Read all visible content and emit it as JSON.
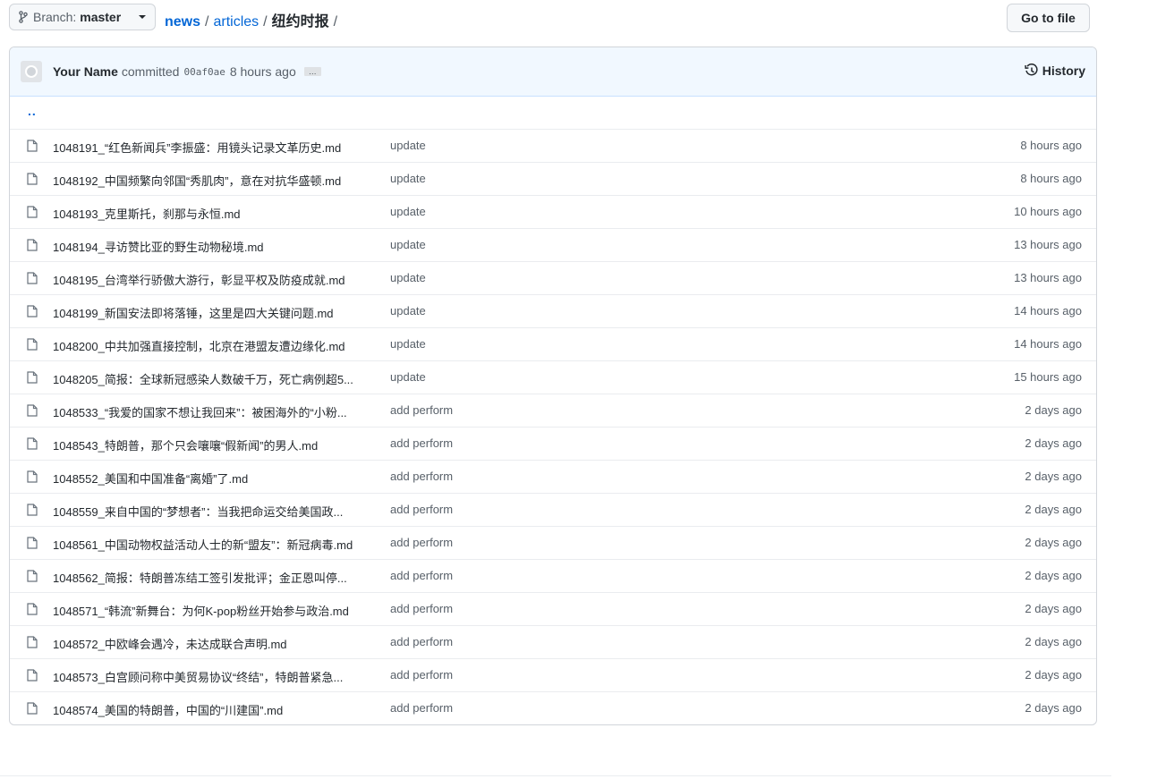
{
  "branch": {
    "label": "Branch:",
    "name": "master"
  },
  "breadcrumb": {
    "root": "news",
    "sep1": "/",
    "segment": "articles",
    "sep2": "/",
    "final": "纽约时报",
    "sep3": "/"
  },
  "goto_file": "Go to file",
  "commit": {
    "author": "Your Name",
    "verb": "committed",
    "sha": "00af0ae",
    "time": "8 hours ago",
    "ellipsis": "…",
    "history": "History"
  },
  "updir": "..",
  "files": [
    {
      "name": "1048191_“红色新闻兵”李振盛：用镜头记录文革历史.md",
      "message": "update",
      "age": "8 hours ago"
    },
    {
      "name": "1048192_中国频繁向邻国“秀肌肉”，意在对抗华盛顿.md",
      "message": "update",
      "age": "8 hours ago"
    },
    {
      "name": "1048193_克里斯托，刹那与永恒.md",
      "message": "update",
      "age": "10 hours ago"
    },
    {
      "name": "1048194_寻访赞比亚的野生动物秘境.md",
      "message": "update",
      "age": "13 hours ago"
    },
    {
      "name": "1048195_台湾举行骄傲大游行，彰显平权及防疫成就.md",
      "message": "update",
      "age": "13 hours ago"
    },
    {
      "name": "1048199_新国安法即将落锤，这里是四大关键问题.md",
      "message": "update",
      "age": "14 hours ago"
    },
    {
      "name": "1048200_中共加强直接控制，北京在港盟友遭边缘化.md",
      "message": "update",
      "age": "14 hours ago"
    },
    {
      "name": "1048205_简报：全球新冠感染人数破千万，死亡病例超5...",
      "message": "update",
      "age": "15 hours ago"
    },
    {
      "name": "1048533_“我爱的国家不想让我回来”：被困海外的“小粉...",
      "message": "add perform",
      "age": "2 days ago"
    },
    {
      "name": "1048543_特朗普，那个只会嚷嚷“假新闻”的男人.md",
      "message": "add perform",
      "age": "2 days ago"
    },
    {
      "name": "1048552_美国和中国准备“离婚”了.md",
      "message": "add perform",
      "age": "2 days ago"
    },
    {
      "name": "1048559_来自中国的“梦想者”：当我把命运交给美国政...",
      "message": "add perform",
      "age": "2 days ago"
    },
    {
      "name": "1048561_中国动物权益活动人士的新“盟友”：新冠病毒.md",
      "message": "add perform",
      "age": "2 days ago"
    },
    {
      "name": "1048562_简报：特朗普冻结工签引发批评；金正恩叫停...",
      "message": "add perform",
      "age": "2 days ago"
    },
    {
      "name": "1048571_“韩流”新舞台：为何K-pop粉丝开始参与政治.md",
      "message": "add perform",
      "age": "2 days ago"
    },
    {
      "name": "1048572_中欧峰会遇冷，未达成联合声明.md",
      "message": "add perform",
      "age": "2 days ago"
    },
    {
      "name": "1048573_白宫顾问称中美贸易协议“终结”，特朗普紧急...",
      "message": "add perform",
      "age": "2 days ago"
    },
    {
      "name": "1048574_美国的特朗普，中国的“川建国”.md",
      "message": "add perform",
      "age": "2 days ago"
    }
  ]
}
